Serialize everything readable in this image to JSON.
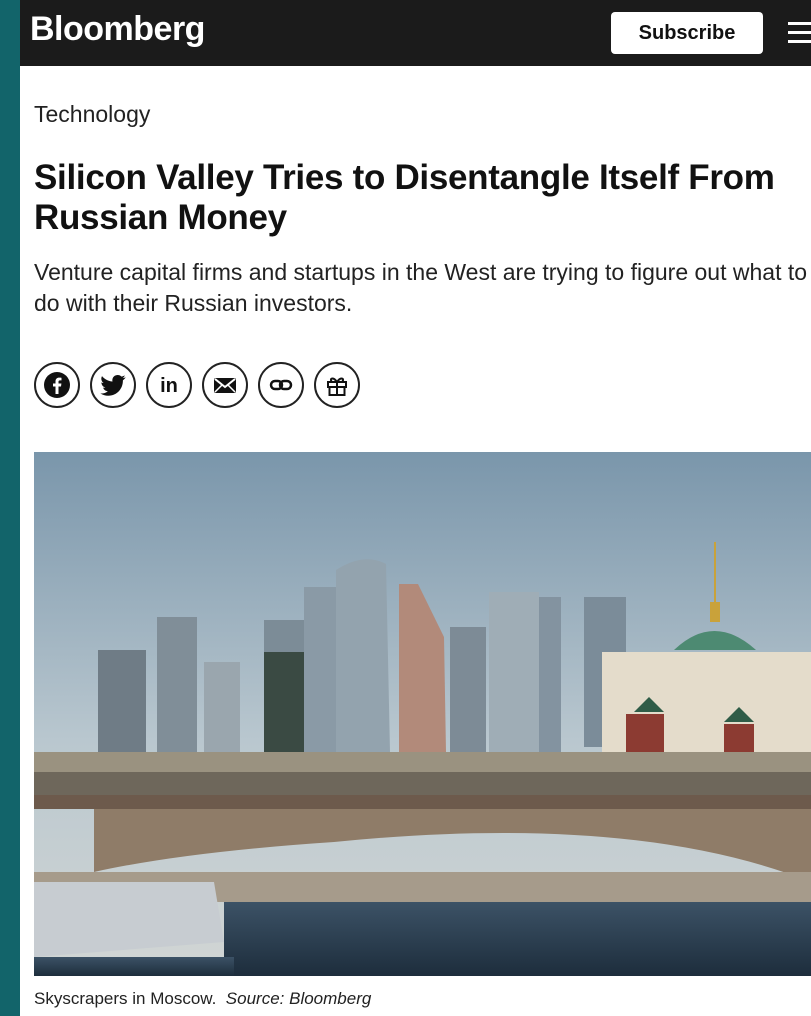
{
  "header": {
    "logo": "Bloomberg",
    "subscribe_label": "Subscribe",
    "menu_icon": "hamburger-menu-icon",
    "bar_color": "#1b1b1b"
  },
  "article": {
    "section": "Technology",
    "headline": "Silicon Valley Tries to Disentangle Itself From Russian Money",
    "dek": "Venture capital firms and startups in the West are trying to figure out what to do with their Russian investors.",
    "share_icons": [
      "facebook-icon",
      "twitter-icon",
      "linkedin-icon",
      "email-icon",
      "link-icon",
      "gift-icon"
    ],
    "image_caption": "Skyscrapers in Moscow.",
    "image_source": "Source: Bloomberg"
  },
  "colors": {
    "page_background": "#12646a",
    "text": "#111111"
  }
}
